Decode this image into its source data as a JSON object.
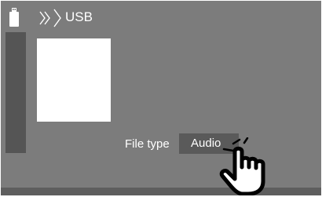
{
  "header": {
    "usb_icon": "usb-drive-icon",
    "breadcrumb_icon": "double-chevron-right-icon",
    "source_label": "USB"
  },
  "main": {
    "artwork": "album-artwork-placeholder",
    "file_type": {
      "label": "File type",
      "value": "Audio"
    }
  },
  "overlay": {
    "pointer_icon": "touching-hand-icon"
  },
  "colors": {
    "background": "#7c7c7c",
    "panel_dark": "#5a5a5a",
    "text": "#ffffff"
  }
}
